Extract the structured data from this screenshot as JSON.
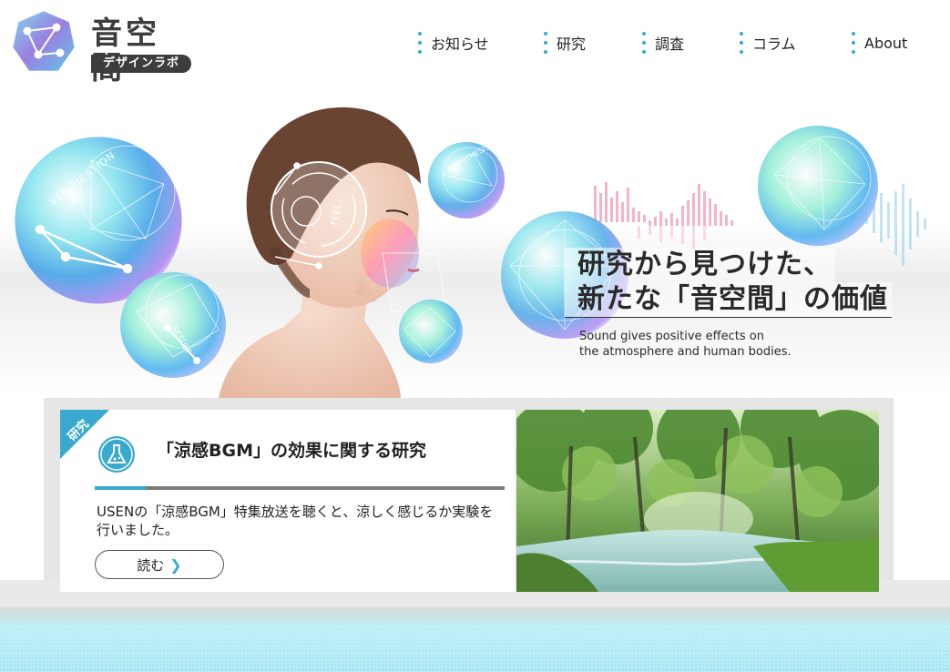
{
  "logo": {
    "title": "音空間",
    "subtitle": "デザインラボ"
  },
  "nav": {
    "items": [
      {
        "label": "お知らせ"
      },
      {
        "label": "研究"
      },
      {
        "label": "調査"
      },
      {
        "label": "コラム"
      },
      {
        "label": "About"
      }
    ]
  },
  "hero": {
    "heading_line1": "研究から見つけた、",
    "heading_line2": "新たな「音空間」の価値",
    "subtext_line1": "Sound gives positive effects on",
    "subtext_line2": "the atmosphere and human bodies.",
    "sphere_labels": [
      "VERIFICATION",
      "RESULT",
      "FEEL",
      "HYPOTHESIS"
    ]
  },
  "card": {
    "badge": "研究",
    "title": "「涼感BGM」の効果に関する研究",
    "body": "USENの「涼感BGM」特集放送を聴くと、涼しく感じるか実験を行いました。",
    "read_label": "読む",
    "read_arrow": "❯"
  },
  "colors": {
    "accent": "#3aa9cf",
    "dark": "#3d3d3d",
    "stage_blue": "#a8e6f3"
  }
}
